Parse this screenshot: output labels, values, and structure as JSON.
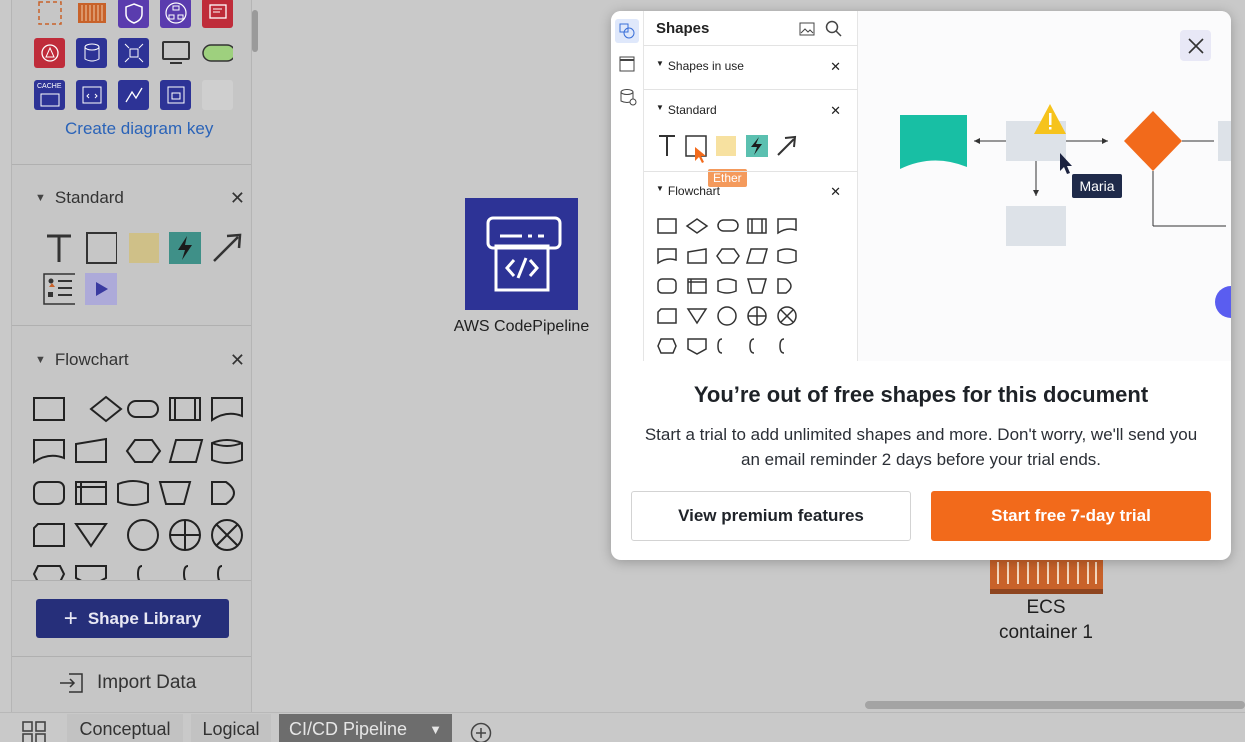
{
  "left_panel": {
    "create_key_label": "Create diagram key",
    "mini_icon_labels": {
      "cache": "CACHE"
    },
    "sections": [
      {
        "title": "Standard",
        "close": "✕"
      },
      {
        "title": "Flowchart",
        "close": "✕"
      }
    ],
    "shape_library_label": "Shape Library",
    "import_label": "Import Data"
  },
  "canvas": {
    "codepipeline_label": "AWS CodePipeline",
    "ecs_label_line1": "ECS",
    "ecs_label_line2": "container 1"
  },
  "tabs": [
    {
      "label": "Conceptual"
    },
    {
      "label": "Logical"
    },
    {
      "label": "CI/CD Pipeline",
      "active": true
    }
  ],
  "modal": {
    "preview": {
      "panel_title": "Shapes",
      "sections": [
        "Shapes in use",
        "Standard",
        "Flowchart"
      ],
      "cursor_labels": [
        "Ether",
        "Maria"
      ]
    },
    "title": "You’re out of free shapes for this document",
    "body": "Start a trial to add unlimited shapes and more. Don't worry, we'll send you an email reminder 2 days before your trial ends.",
    "secondary_button": "View premium features",
    "primary_button": "Start free 7-day trial"
  },
  "colors": {
    "accent_orange": "#f26a1b",
    "shape_library_button": "#262f7a",
    "aws_blue": "#2d3396",
    "link_blue": "#2a63b8"
  }
}
